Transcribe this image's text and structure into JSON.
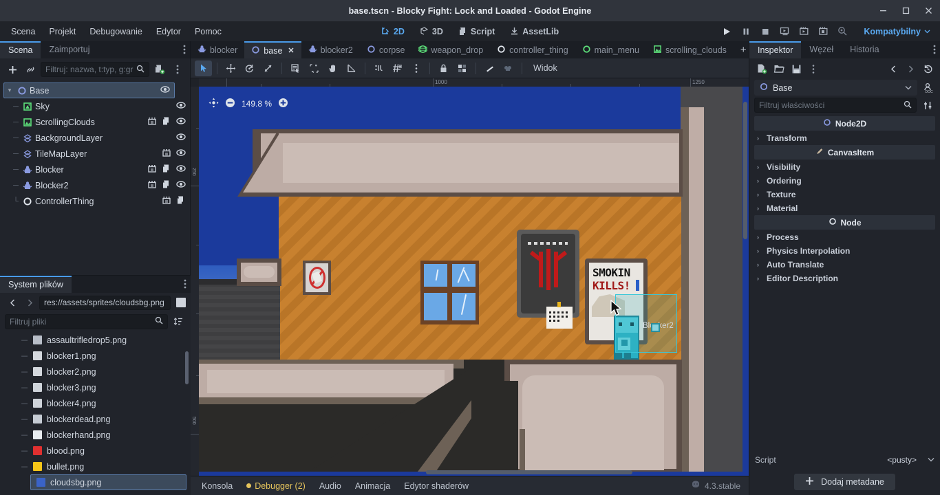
{
  "window": {
    "title": "base.tscn - Blocky Fight: Lock and Loaded - Godot Engine",
    "minimize": "–",
    "maximize": "☐",
    "close": "✕"
  },
  "menubar": {
    "items": [
      {
        "label": "Scena",
        "name": "menu-scena"
      },
      {
        "label": "Projekt",
        "name": "menu-projekt"
      },
      {
        "label": "Debugowanie",
        "name": "menu-debugowanie"
      },
      {
        "label": "Edytor",
        "name": "menu-edytor"
      },
      {
        "label": "Pomoc",
        "name": "menu-pomoc"
      }
    ],
    "modes": [
      {
        "label": "2D",
        "active": true
      },
      {
        "label": "3D",
        "active": false
      },
      {
        "label": "Script",
        "active": false
      },
      {
        "label": "AssetLib",
        "active": false
      }
    ],
    "run_buttons": [
      "play-icon",
      "pause-icon",
      "stop-icon",
      "run-project-icon",
      "play-scene-icon",
      "play-custom-scene-icon",
      "movie-maker-icon"
    ],
    "renderer": "Kompatybilny"
  },
  "scene_dock": {
    "tabs": [
      {
        "label": "Scena",
        "active": true
      },
      {
        "label": "Zaimportuj",
        "active": false
      }
    ],
    "toolbar": {
      "add_icon": "plus-icon",
      "link_icon": "instantiate-child-scene-icon",
      "filter_placeholder": "Filtruj: nazwa, t:typ, g:gr",
      "search_icon": "search-icon",
      "create_script_icon": "attach-script-icon",
      "more_icon": "more-options-icon"
    },
    "tree": [
      {
        "label": "Base",
        "icon": "node2d-icon",
        "depth": 0,
        "selected": true,
        "expanded": true,
        "visible_icon": true,
        "anim_icon": false,
        "script_icon": false
      },
      {
        "label": "Sky",
        "icon": "sprite2d-icon",
        "depth": 1,
        "selected": false,
        "visible_icon": true,
        "anim_icon": false,
        "script_icon": false
      },
      {
        "label": "ScrollingClouds",
        "icon": "parallax-icon",
        "depth": 1,
        "selected": false,
        "visible_icon": true,
        "anim_icon": true,
        "script_icon": true
      },
      {
        "label": "BackgroundLayer",
        "icon": "tilemap-icon",
        "depth": 1,
        "selected": false,
        "visible_icon": true,
        "anim_icon": false,
        "script_icon": false
      },
      {
        "label": "TileMapLayer",
        "icon": "tilemap-icon",
        "depth": 1,
        "selected": false,
        "visible_icon": true,
        "anim_icon": true,
        "script_icon": false
      },
      {
        "label": "Blocker",
        "icon": "character-icon",
        "depth": 1,
        "selected": false,
        "visible_icon": true,
        "anim_icon": true,
        "script_icon": true
      },
      {
        "label": "Blocker2",
        "icon": "character-icon",
        "depth": 1,
        "selected": false,
        "visible_icon": true,
        "anim_icon": true,
        "script_icon": true
      },
      {
        "label": "ControllerThing",
        "icon": "node-icon",
        "depth": 1,
        "selected": false,
        "visible_icon": false,
        "anim_icon": true,
        "script_icon": true
      }
    ]
  },
  "filesystem_dock": {
    "tabs": [
      {
        "label": "System plików",
        "active": true
      }
    ],
    "back_icon": "chevron-left-icon",
    "forward_icon": "chevron-right-icon",
    "path": "res://assets/sprites/cloudsbg.png",
    "filter_placeholder": "Filtruj pliki",
    "search_icon": "search-icon",
    "sort_icon": "sort-icon",
    "files": [
      {
        "name": "assaultrifledrop5.png",
        "icon": "texture-icon",
        "color": "#b8bec8",
        "selected": false
      },
      {
        "name": "blocker1.png",
        "icon": "texture-icon",
        "color": "#d4d8de",
        "selected": false
      },
      {
        "name": "blocker2.png",
        "icon": "texture-icon",
        "color": "#d4d8de",
        "selected": false
      },
      {
        "name": "blocker3.png",
        "icon": "texture-icon",
        "color": "#cfd4da",
        "selected": false
      },
      {
        "name": "blocker4.png",
        "icon": "texture-icon",
        "color": "#cfd4da",
        "selected": false
      },
      {
        "name": "blockerdead.png",
        "icon": "texture-icon",
        "color": "#c6ccd4",
        "selected": false
      },
      {
        "name": "blockerhand.png",
        "icon": "texture-icon",
        "color": "#e8ecf0",
        "selected": false
      },
      {
        "name": "blood.png",
        "icon": "texture-icon",
        "color": "#e03030",
        "selected": false
      },
      {
        "name": "bullet.png",
        "icon": "texture-icon",
        "color": "#f5c518",
        "selected": false
      },
      {
        "name": "cloudsbg.png",
        "icon": "texture-icon",
        "color": "#3a63c8",
        "selected": true
      }
    ]
  },
  "scene_tabs": [
    {
      "label": "blocker",
      "icon": "character-icon",
      "active": false,
      "closable": false
    },
    {
      "label": "base",
      "icon": "node2d-icon",
      "active": true,
      "closable": true
    },
    {
      "label": "blocker2",
      "icon": "character-icon",
      "active": false,
      "closable": false
    },
    {
      "label": "corpse",
      "icon": "node2d-icon",
      "active": false,
      "closable": false
    },
    {
      "label": "weapon_drop",
      "icon": "rigidbody-icon",
      "active": false,
      "closable": false
    },
    {
      "label": "controller_thing",
      "icon": "node-icon",
      "active": false,
      "closable": false
    },
    {
      "label": "main_menu",
      "icon": "control-icon",
      "active": false,
      "closable": false
    },
    {
      "label": "scrolling_clouds",
      "icon": "parallax-icon",
      "active": false,
      "closable": false
    }
  ],
  "scene_tabs_extra": {
    "add_label": "+",
    "expand_icon": "distraction-free-icon"
  },
  "canvas_toolbar": {
    "tools": [
      {
        "name": "select-mode-tool",
        "active": true
      },
      {
        "name": "move-mode-tool",
        "active": false
      },
      {
        "name": "rotate-mode-tool",
        "active": false
      },
      {
        "name": "scale-mode-tool",
        "active": false
      },
      {
        "name": "list-select-tool",
        "active": false
      },
      {
        "name": "pivot-tool",
        "active": false
      },
      {
        "name": "pan-mode-tool",
        "active": false
      },
      {
        "name": "ruler-mode-tool",
        "active": false
      },
      {
        "name": "snap-mode-tool",
        "active": false
      },
      {
        "name": "grid-snap-tool",
        "active": false
      },
      {
        "name": "snap-options-tool",
        "active": false
      },
      {
        "name": "lock-tool",
        "active": false
      },
      {
        "name": "group-tool",
        "active": false
      },
      {
        "name": "skeleton-bone-tool",
        "active": false
      },
      {
        "name": "skeleton-options-tool",
        "active": false
      }
    ],
    "view_menu": "Widok"
  },
  "viewport": {
    "zoom_label": "149.8 %",
    "zoom_out_icon": "minus-circle-icon",
    "zoom_in_icon": "plus-circle-icon",
    "center_icon": "center-view-icon",
    "ruler_labels_x": [
      "1000",
      "1250"
    ],
    "ruler_labels_y": [
      "250",
      "500"
    ],
    "selected_node_label": "Blocker2",
    "poster_line1": "SMOKIN",
    "poster_line2": "KILLS!"
  },
  "bottom_panel": {
    "items": [
      {
        "label": "Konsola",
        "warn": false
      },
      {
        "label": "Debugger (2)",
        "warn": true
      },
      {
        "label": "Audio",
        "warn": false
      },
      {
        "label": "Animacja",
        "warn": false
      },
      {
        "label": "Edytor shaderów",
        "warn": false
      }
    ],
    "version": "4.3.stable",
    "version_icon": "godot-logo-icon"
  },
  "inspector": {
    "tabs": [
      {
        "label": "Inspektor",
        "active": true
      },
      {
        "label": "Węzeł",
        "active": false
      },
      {
        "label": "Historia",
        "active": false
      }
    ],
    "toolbar": {
      "new_resource_icon": "new-resource-icon",
      "load_icon": "folder-open-icon",
      "save_icon": "save-icon",
      "tools_icon": "more-options-icon",
      "prev_icon": "chevron-left-icon",
      "next_icon": "chevron-right-icon",
      "history_icon": "history-icon",
      "docs_icon": "open-documentation-icon",
      "settings_icon": "object-settings-icon"
    },
    "object_name": "Base",
    "object_icon": "node2d-icon",
    "filter_placeholder": "Filtruj właściwości",
    "sections": [
      {
        "type": "category",
        "label": "Node2D",
        "icon": "node2d-icon"
      },
      {
        "type": "group",
        "label": "Transform"
      },
      {
        "type": "category",
        "label": "CanvasItem",
        "icon": "canvasitem-icon"
      },
      {
        "type": "group",
        "label": "Visibility"
      },
      {
        "type": "group",
        "label": "Ordering"
      },
      {
        "type": "group",
        "label": "Texture"
      },
      {
        "type": "group",
        "label": "Material"
      },
      {
        "type": "category",
        "label": "Node",
        "icon": "node-icon"
      },
      {
        "type": "group",
        "label": "Process"
      },
      {
        "type": "group",
        "label": "Physics Interpolation"
      },
      {
        "type": "group",
        "label": "Auto Translate"
      },
      {
        "type": "group",
        "label": "Editor Description"
      }
    ],
    "script_label": "Script",
    "script_value": "<pusty>",
    "add_metadata_label": "Dodaj metadane"
  },
  "colors": {
    "accent": "#4a9bea",
    "selection": "#3c4a5c",
    "warn": "#e5c45c",
    "sky": "#1b3a9c",
    "floor": "#c8812f",
    "wall": "#b9aaa4"
  }
}
